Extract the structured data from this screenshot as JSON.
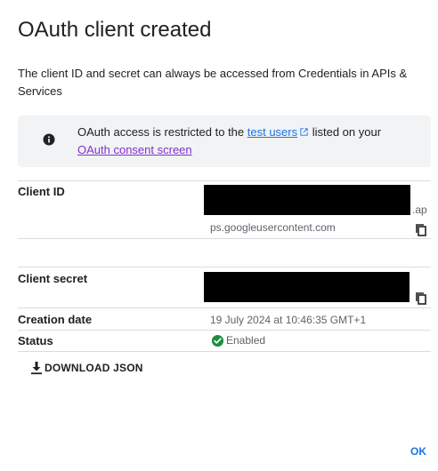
{
  "dialog": {
    "title": "OAuth client created",
    "intro": "The client ID and secret can always be accessed from Credentials in APIs & Services"
  },
  "notice": {
    "icon": "info-icon",
    "text_before": "OAuth access is restricted to the ",
    "test_users_link": "test users",
    "text_after": " listed on your ",
    "consent_link": "OAuth consent screen"
  },
  "details": {
    "client_id": {
      "label": "Client ID",
      "value_tail": ".ap",
      "value_line2": "ps.googleusercontent.com"
    },
    "client_secret": {
      "label": "Client secret"
    },
    "creation_date": {
      "label": "Creation date",
      "value": "19 July 2024 at 10:46:35 GMT+1"
    },
    "status": {
      "label": "Status",
      "value": "Enabled",
      "color": "#1e8e3e"
    }
  },
  "actions": {
    "download_label": "DOWNLOAD JSON",
    "ok_label": "OK"
  },
  "colors": {
    "link": "#1a73e8",
    "link_visited": "#8430ce",
    "notice_bg": "#f1f3f4",
    "divider": "#dadce0"
  }
}
